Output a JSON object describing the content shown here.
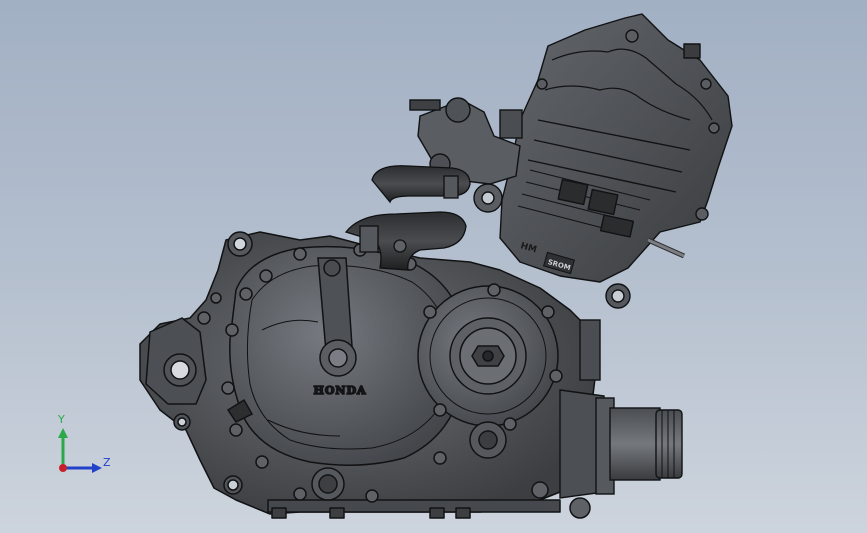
{
  "model": {
    "brand_text": "HONDA",
    "cylinder_marking": "HM",
    "badge_text": "SROM"
  },
  "triad": {
    "y_label": "Y",
    "z_label": "Z",
    "y_color": "#2aa84a",
    "z_color": "#2340c9",
    "origin_color": "#c8202a"
  },
  "colors": {
    "background_top": "#a2b0c4",
    "background_bottom": "#cdd4dd",
    "metal_dark": "#3e4043",
    "metal_mid": "#55585c",
    "metal_light": "#6c7075",
    "edge": "#111214"
  }
}
